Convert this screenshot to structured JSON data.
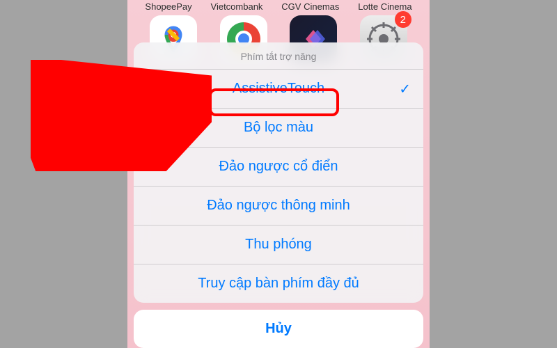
{
  "homescreen": {
    "apps": [
      {
        "label": "ShopeePay"
      },
      {
        "label": "Vietcombank"
      },
      {
        "label": "CGV Cinemas"
      },
      {
        "label": "Lotte Cinema"
      }
    ],
    "badge_settings": "2"
  },
  "sheet": {
    "title": "Phím tắt trợ năng",
    "items": [
      {
        "label": "AssistiveTouch",
        "checked": true
      },
      {
        "label": "Bộ lọc màu",
        "checked": false
      },
      {
        "label": "Đảo ngược cổ điển",
        "checked": false
      },
      {
        "label": "Đảo ngược thông minh",
        "checked": false
      },
      {
        "label": "Thu phóng",
        "checked": false
      },
      {
        "label": "Truy cập bàn phím đầy đủ",
        "checked": false
      }
    ],
    "cancel": "Hủy"
  },
  "annotation": {
    "highlight_target": "AssistiveTouch"
  }
}
